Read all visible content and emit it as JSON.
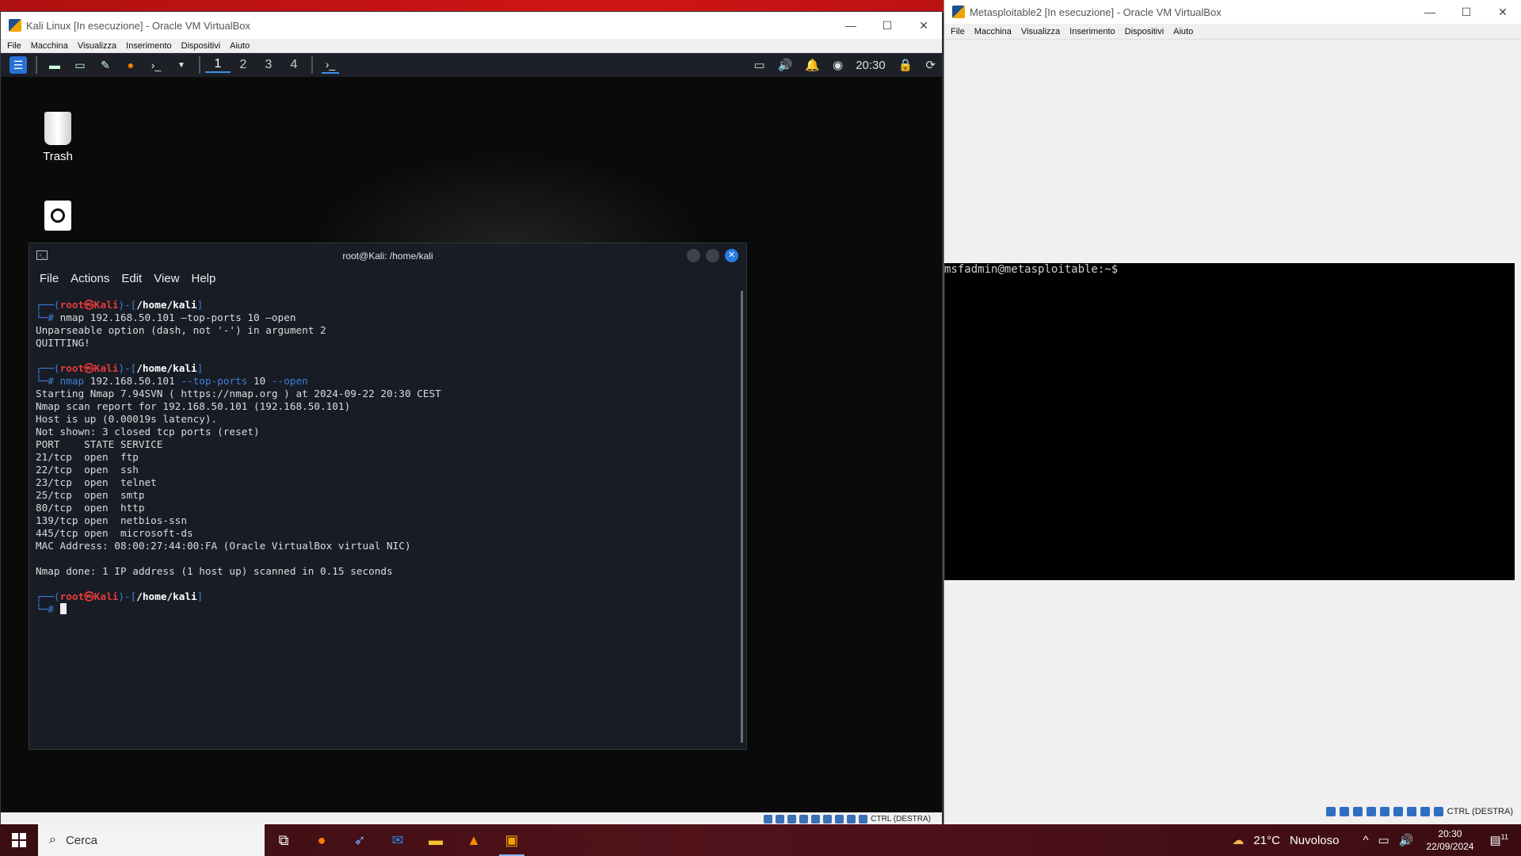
{
  "kali_window": {
    "title": "Kali Linux [In esecuzione] - Oracle VM VirtualBox",
    "menu": [
      "File",
      "Macchina",
      "Visualizza",
      "Inserimento",
      "Dispositivi",
      "Aiuto"
    ],
    "panel": {
      "workspaces": [
        "1",
        "2",
        "3",
        "4"
      ],
      "active_workspace": "1",
      "clock": "20:30"
    },
    "desktop_icons": {
      "trash": "Trash"
    },
    "status_host_key": "CTRL (DESTRA)"
  },
  "terminal": {
    "title": "root@Kali: /home/kali",
    "menu": [
      "File",
      "Actions",
      "Edit",
      "View",
      "Help"
    ],
    "prompt": {
      "open": "┌──(",
      "user": "root㉿Kali",
      "sep": ")-[",
      "path": "/home/kali",
      "close": "]",
      "hash": "└─#"
    },
    "cmd1": "nmap 192.168.50.101 —top-ports 10 —open",
    "out1": [
      "Unparseable option (dash, not '-') in argument 2",
      "QUITTING!"
    ],
    "cmd2_bin": "nmap",
    "cmd2_args": "192.168.50.101",
    "cmd2_opt1": "--top-ports",
    "cmd2_val": "10",
    "cmd2_opt2": "--open",
    "out2": [
      "Starting Nmap 7.94SVN ( https://nmap.org ) at 2024-09-22 20:30 CEST",
      "Nmap scan report for 192.168.50.101 (192.168.50.101)",
      "Host is up (0.00019s latency).",
      "Not shown: 3 closed tcp ports (reset)",
      "PORT    STATE SERVICE",
      "21/tcp  open  ftp",
      "22/tcp  open  ssh",
      "23/tcp  open  telnet",
      "25/tcp  open  smtp",
      "80/tcp  open  http",
      "139/tcp open  netbios-ssn",
      "445/tcp open  microsoft-ds",
      "MAC Address: 08:00:27:44:00:FA (Oracle VirtualBox virtual NIC)",
      "",
      "Nmap done: 1 IP address (1 host up) scanned in 0.15 seconds"
    ]
  },
  "meta_window": {
    "title": "Metasploitable2 [In esecuzione] - Oracle VM VirtualBox",
    "menu": [
      "File",
      "Macchina",
      "Visualizza",
      "Inserimento",
      "Dispositivi",
      "Aiuto"
    ],
    "console_prompt": "msfadmin@metasploitable:~$",
    "status_host_key": "CTRL (DESTRA)"
  },
  "taskbar": {
    "search_placeholder": "Cerca",
    "weather_temp": "21°C",
    "weather_text": "Nuvoloso",
    "time": "20:30",
    "date": "22/09/2024",
    "notification_count": "11"
  }
}
